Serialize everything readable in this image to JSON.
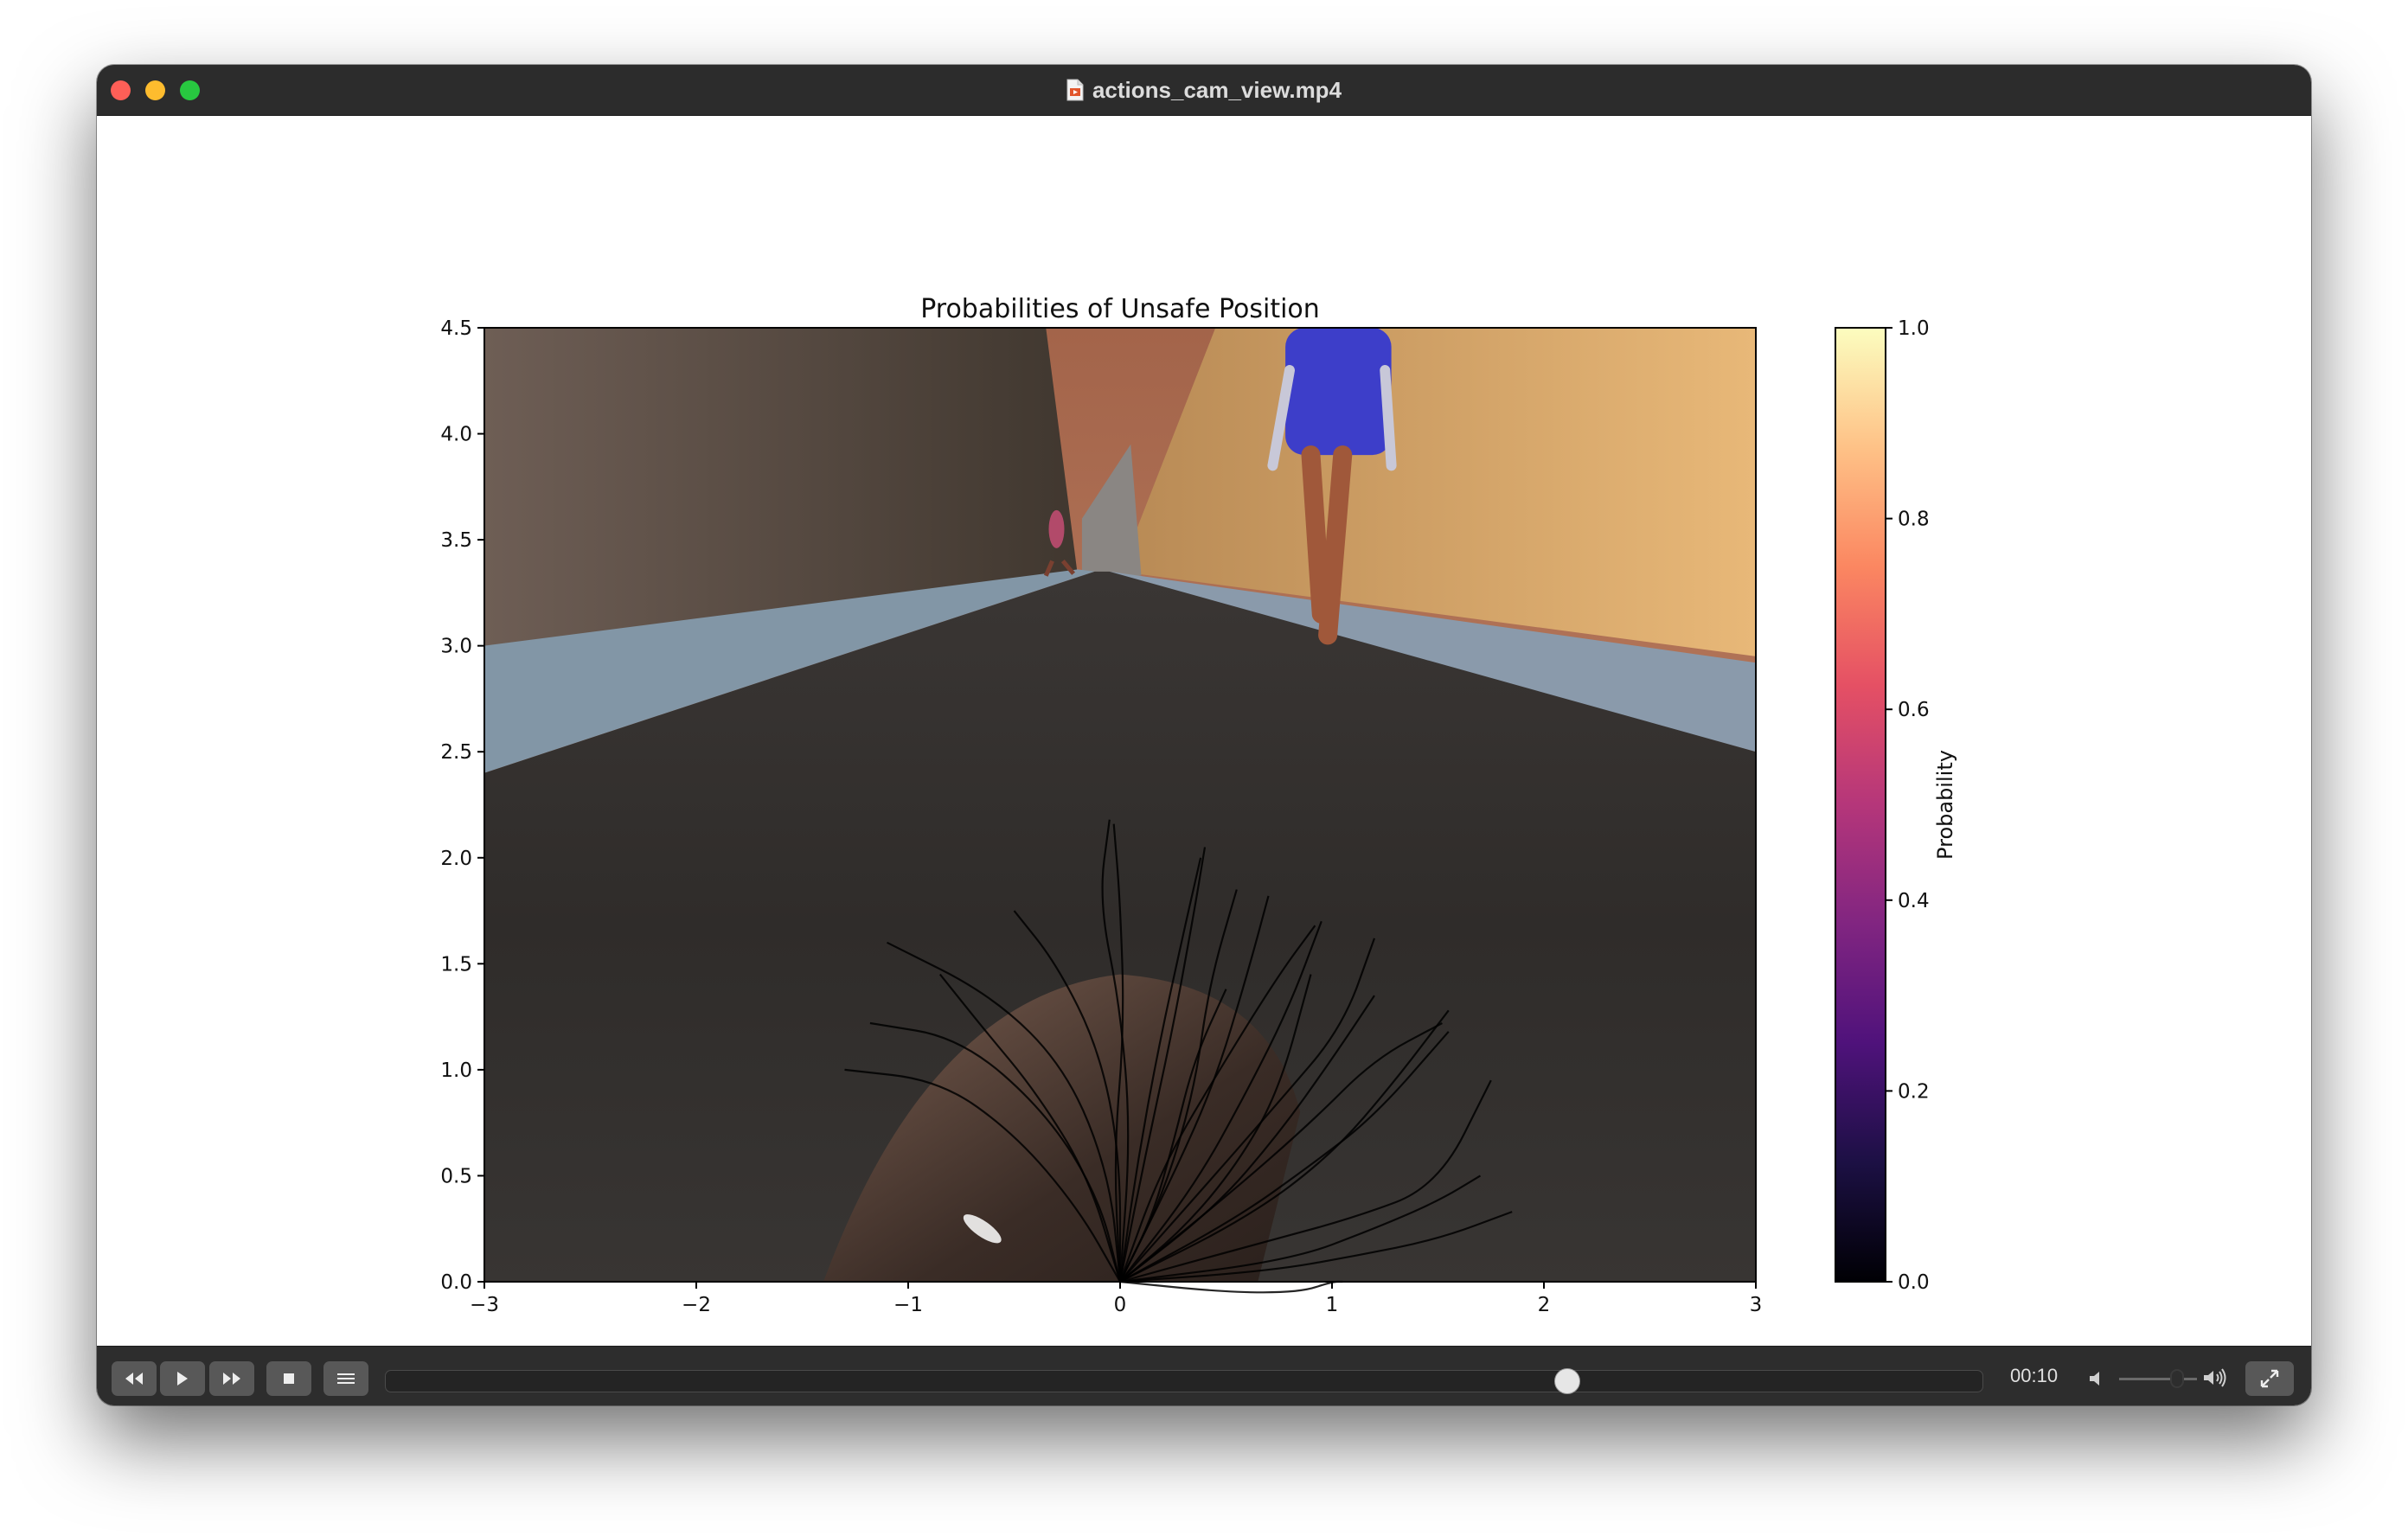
{
  "window": {
    "title": "actions_cam_view.mp4"
  },
  "player": {
    "time": "00:10",
    "progress": 0.743,
    "volume": 0.8,
    "buttons": {
      "rewind": "rewind-icon",
      "play": "play-icon",
      "fast_forward": "fast-forward-icon",
      "stop": "stop-icon",
      "playlist": "playlist-icon",
      "fullscreen": "fullscreen-icon"
    }
  },
  "chart_data": {
    "type": "heatmap",
    "title": "Probabilities of Unsafe Position",
    "xlim": [
      -3,
      3
    ],
    "ylim": [
      0,
      4.5
    ],
    "x_ticks": [
      "−3",
      "−2",
      "−1",
      "0",
      "1",
      "2",
      "3"
    ],
    "y_ticks": [
      "0.0",
      "0.5",
      "1.0",
      "1.5",
      "2.0",
      "2.5",
      "3.0",
      "3.5",
      "4.0",
      "4.5"
    ],
    "colorbar": {
      "label": "Probability",
      "range": [
        0,
        1
      ],
      "ticks": [
        "0.0",
        "0.2",
        "0.4",
        "0.6",
        "0.8",
        "1.0"
      ],
      "colormap": "magma",
      "stops": [
        "#000004",
        "#1c1044",
        "#4f127b",
        "#812581",
        "#b5367a",
        "#e55064",
        "#fb8761",
        "#fec287",
        "#fcfdbf"
      ]
    },
    "background": "camera view of a street with pedestrians overlaid on plot area",
    "trajectories": [
      [
        [
          0,
          0
        ],
        [
          -0.03,
          0.6
        ],
        [
          0.02,
          1.2
        ],
        [
          0.0,
          1.8
        ],
        [
          -0.03,
          2.16
        ]
      ],
      [
        [
          0,
          0
        ],
        [
          0.08,
          0.55
        ],
        [
          0.18,
          1.1
        ],
        [
          0.3,
          1.65
        ],
        [
          0.38,
          2.0
        ]
      ],
      [
        [
          0,
          0
        ],
        [
          0.2,
          0.4
        ],
        [
          0.35,
          0.9
        ],
        [
          0.42,
          1.4
        ],
        [
          0.55,
          1.85
        ]
      ],
      [
        [
          0,
          0
        ],
        [
          0.35,
          0.45
        ],
        [
          0.6,
          0.9
        ],
        [
          0.8,
          1.3
        ],
        [
          0.95,
          1.7
        ]
      ],
      [
        [
          0,
          0
        ],
        [
          0.45,
          0.35
        ],
        [
          0.75,
          0.7
        ],
        [
          1.0,
          1.05
        ],
        [
          1.2,
          1.35
        ]
      ],
      [
        [
          0,
          0
        ],
        [
          0.55,
          0.3
        ],
        [
          0.9,
          0.55
        ],
        [
          1.2,
          0.78
        ],
        [
          1.55,
          1.18
        ]
      ],
      [
        [
          0,
          0
        ],
        [
          0.65,
          0.18
        ],
        [
          1.1,
          0.3
        ],
        [
          1.5,
          0.45
        ],
        [
          1.75,
          0.95
        ]
      ],
      [
        [
          0,
          0
        ],
        [
          0.7,
          0.05
        ],
        [
          1.1,
          0.12
        ],
        [
          1.5,
          0.2
        ],
        [
          1.85,
          0.33
        ]
      ],
      [
        [
          0,
          0
        ],
        [
          -0.2,
          0.35
        ],
        [
          -0.5,
          0.7
        ],
        [
          -0.85,
          0.95
        ],
        [
          -1.3,
          1.0
        ]
      ],
      [
        [
          0,
          0
        ],
        [
          -0.1,
          0.4
        ],
        [
          -0.35,
          0.8
        ],
        [
          -0.75,
          1.15
        ],
        [
          -1.18,
          1.22
        ]
      ],
      [
        [
          0,
          0
        ],
        [
          -0.05,
          0.5
        ],
        [
          -0.25,
          1.0
        ],
        [
          -0.6,
          1.35
        ],
        [
          -1.1,
          1.6
        ]
      ],
      [
        [
          0,
          0
        ],
        [
          0.0,
          0.6
        ],
        [
          -0.1,
          1.1
        ],
        [
          -0.3,
          1.5
        ],
        [
          -0.5,
          1.75
        ]
      ],
      [
        [
          0,
          0
        ],
        [
          0.05,
          0.7
        ],
        [
          0.0,
          1.3
        ],
        [
          -0.1,
          1.8
        ],
        [
          -0.05,
          2.18
        ]
      ],
      [
        [
          0,
          0
        ],
        [
          0.12,
          0.6
        ],
        [
          0.25,
          1.2
        ],
        [
          0.35,
          1.75
        ],
        [
          0.4,
          2.05
        ]
      ],
      [
        [
          0,
          0
        ],
        [
          0.25,
          0.5
        ],
        [
          0.45,
          0.95
        ],
        [
          0.6,
          1.45
        ],
        [
          0.7,
          1.82
        ]
      ],
      [
        [
          0,
          0
        ],
        [
          0.4,
          0.45
        ],
        [
          0.75,
          0.85
        ],
        [
          1.05,
          1.2
        ],
        [
          1.2,
          1.62
        ]
      ],
      [
        [
          0,
          0
        ],
        [
          0.5,
          0.4
        ],
        [
          0.9,
          0.75
        ],
        [
          1.2,
          1.05
        ],
        [
          1.52,
          1.22
        ]
      ],
      [
        [
          0,
          0
        ],
        [
          0.3,
          0.25
        ],
        [
          0.55,
          0.55
        ],
        [
          0.75,
          0.9
        ],
        [
          0.9,
          1.45
        ]
      ],
      [
        [
          0,
          0
        ],
        [
          0.15,
          0.3
        ],
        [
          0.25,
          0.65
        ],
        [
          0.35,
          1.05
        ],
        [
          0.5,
          1.38
        ]
      ],
      [
        [
          0,
          0
        ],
        [
          0.6,
          0.3
        ],
        [
          1.0,
          0.6
        ],
        [
          1.3,
          0.95
        ],
        [
          1.55,
          1.28
        ]
      ],
      [
        [
          0,
          0
        ],
        [
          0.5,
          -0.05
        ],
        [
          0.85,
          -0.05
        ],
        [
          1.0,
          0.0
        ],
        [
          1.05,
          0.0
        ]
      ],
      [
        [
          0,
          0
        ],
        [
          0.8,
          0.1
        ],
        [
          1.2,
          0.25
        ],
        [
          1.5,
          0.38
        ],
        [
          1.7,
          0.5
        ]
      ],
      [
        [
          0,
          0
        ],
        [
          0.2,
          0.55
        ],
        [
          0.5,
          1.05
        ],
        [
          0.75,
          1.45
        ],
        [
          0.92,
          1.68
        ]
      ],
      [
        [
          0,
          0
        ],
        [
          -0.15,
          0.5
        ],
        [
          -0.4,
          0.9
        ],
        [
          -0.65,
          1.2
        ],
        [
          -0.85,
          1.45
        ]
      ]
    ]
  }
}
